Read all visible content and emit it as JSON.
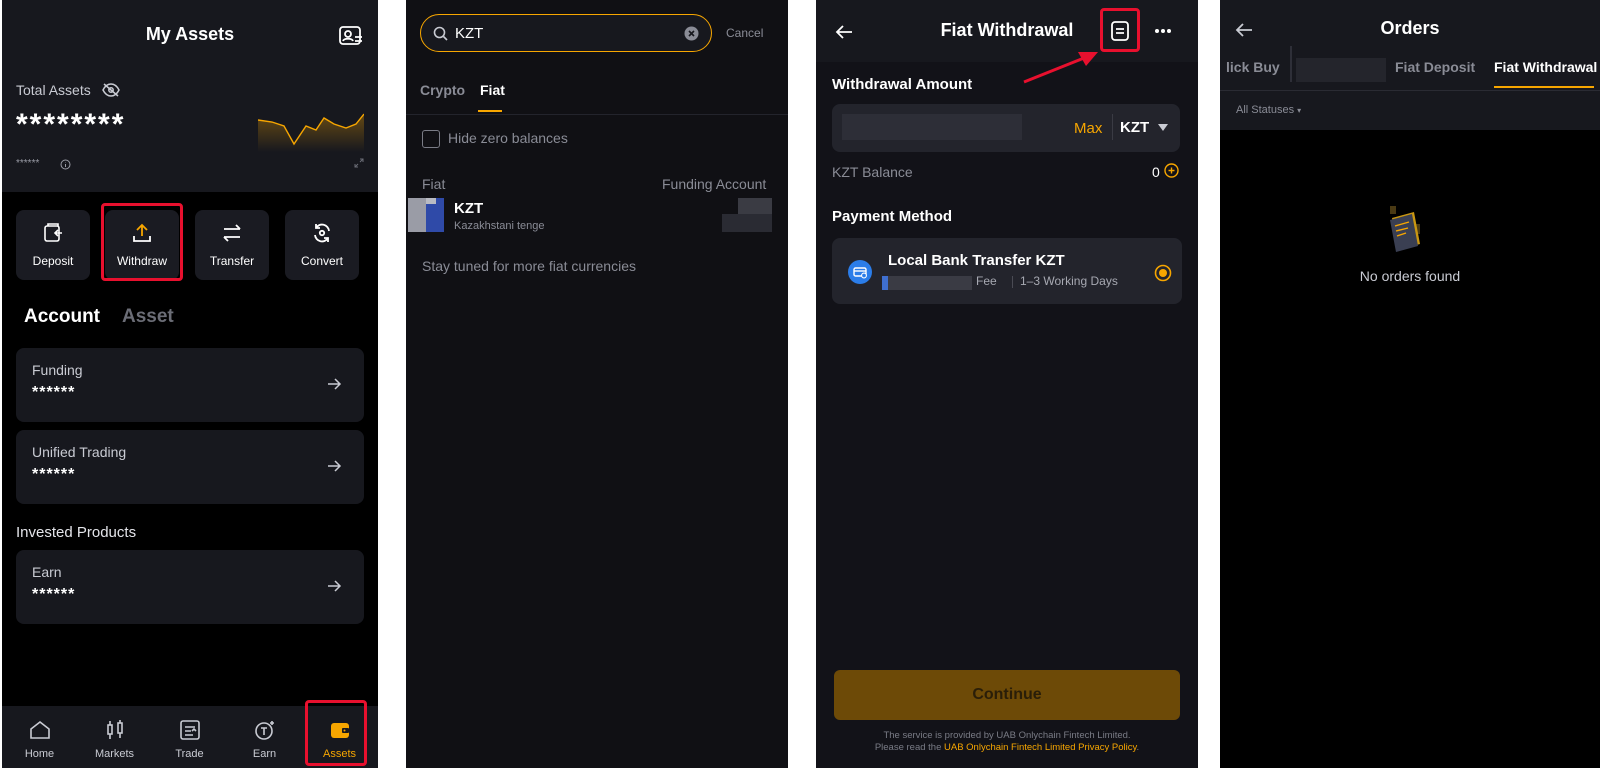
{
  "colors": {
    "accent": "#f7a600",
    "highlight": "#e8102e",
    "background": "#0b0b0f",
    "card": "#17181e"
  },
  "panel1": {
    "title": "My Assets",
    "total_label": "Total Assets",
    "total_value": "********",
    "sub_value": "******",
    "actions": [
      {
        "label": "Deposit",
        "icon": "deposit-icon"
      },
      {
        "label": "Withdraw",
        "icon": "upload-icon"
      },
      {
        "label": "Transfer",
        "icon": "transfer-icon"
      },
      {
        "label": "Convert",
        "icon": "convert-icon"
      }
    ],
    "tabs": {
      "account": "Account",
      "asset": "Asset"
    },
    "accounts": [
      {
        "name": "Funding",
        "value": "******"
      },
      {
        "name": "Unified Trading",
        "value": "******"
      }
    ],
    "invested_label": "Invested Products",
    "invested": [
      {
        "name": "Earn",
        "value": "******"
      }
    ],
    "nav": [
      {
        "label": "Home",
        "icon": "home-icon"
      },
      {
        "label": "Markets",
        "icon": "candlestick-icon"
      },
      {
        "label": "Trade",
        "icon": "trade-icon"
      },
      {
        "label": "Earn",
        "icon": "earn-icon"
      },
      {
        "label": "Assets",
        "icon": "wallet-icon",
        "active": true
      }
    ]
  },
  "panel2": {
    "search_value": "KZT",
    "cancel": "Cancel",
    "tabs": [
      "Crypto",
      "Fiat"
    ],
    "active_tab": "Fiat",
    "hide_zero": "Hide zero balances",
    "col_fiat": "Fiat",
    "col_funding": "Funding Account",
    "currency_code": "KZT",
    "currency_name": "Kazakhstani tenge",
    "note": "Stay tuned for more fiat currencies"
  },
  "panel3": {
    "title": "Fiat Withdrawal",
    "amount_label": "Withdrawal Amount",
    "max": "Max",
    "currency": "KZT",
    "balance_label": "KZT Balance",
    "balance_value": "0",
    "payment_label": "Payment Method",
    "method_name": "Local Bank Transfer KZT",
    "fee_label": "Fee",
    "duration": "1–3 Working Days",
    "continue": "Continue",
    "footer_line1": "The service is provided by UAB Onlychain Fintech Limited.",
    "footer_prefix": "Please read the ",
    "footer_link": "UAB Onlychain Fintech Limited Privacy Policy",
    "footer_suffix": "."
  },
  "panel4": {
    "title": "Orders",
    "tabs": [
      "lick Buy",
      "Fiat Deposit",
      "Fiat Withdrawal"
    ],
    "active_tab": "Fiat Withdrawal",
    "filter": "All Statuses",
    "empty": "No orders found"
  }
}
